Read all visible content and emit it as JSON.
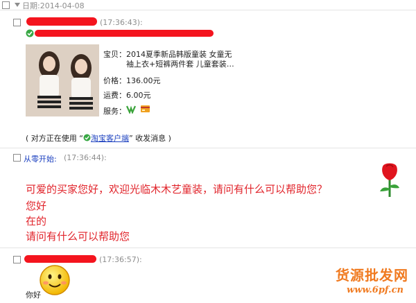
{
  "date_header": "日期:2014-04-08",
  "messages": [
    {
      "time": "(17:36:43):",
      "product": {
        "title_label": "宝贝：",
        "title_line1": "2014夏季新品韩版童装 女童无",
        "title_line2": "袖上衣+短裤两件套 儿童套装…",
        "price_label": "价格：",
        "price": "136.00元",
        "shipping_label": "运费：",
        "shipping": "6.00元",
        "service_label": "服务："
      },
      "client_note_prefix": "( 对方正在使用 “",
      "client_name": "淘宝客户端",
      "client_note_suffix": "” 收发消息 )"
    },
    {
      "sender": "从零开始:",
      "time": "(17:36:44):",
      "lines": [
        "可爱的买家您好，欢迎光临木木艺童装，请问有什么可以帮助您？",
        "您好",
        "在的",
        "请问有什么可以帮助您"
      ]
    },
    {
      "time": "(17:36:57):",
      "text": "你好"
    }
  ],
  "watermark": {
    "line1": "货源批发网",
    "line2": "www.6pf.cn"
  },
  "colors": {
    "message_red": "#e1242b",
    "redaction": "#f4141e",
    "watermark": "#f07a20",
    "sender_blue": "#1a3fbf",
    "link_blue": "#1a3fbf"
  }
}
